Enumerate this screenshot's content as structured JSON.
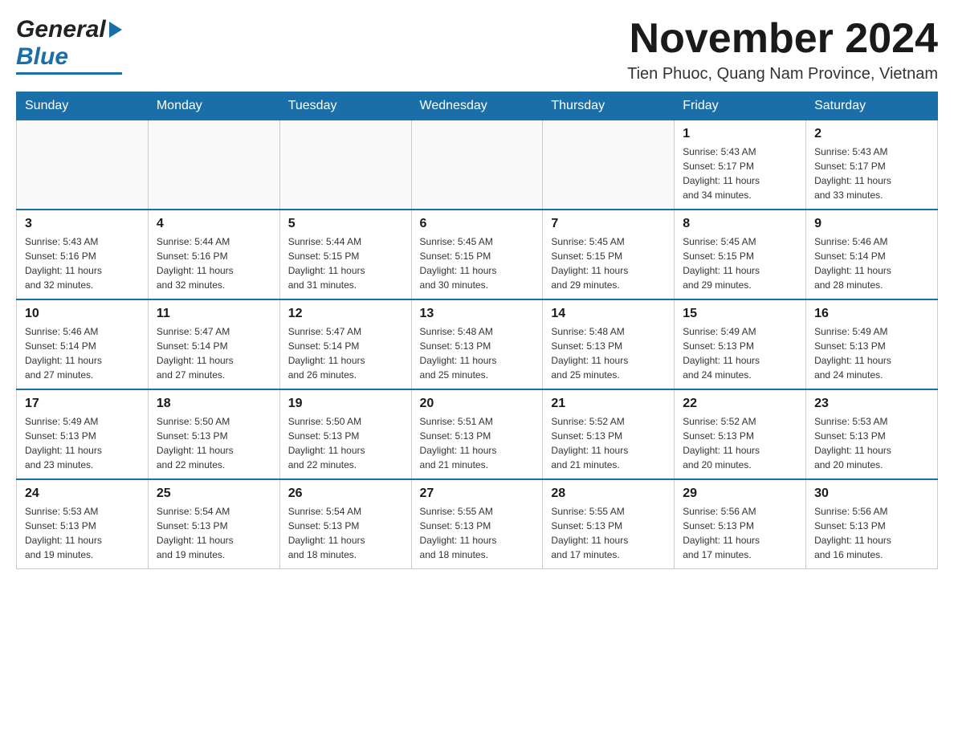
{
  "header": {
    "logo_general": "General",
    "logo_blue": "Blue",
    "month_title": "November 2024",
    "location": "Tien Phuoc, Quang Nam Province, Vietnam"
  },
  "calendar": {
    "days_of_week": [
      "Sunday",
      "Monday",
      "Tuesday",
      "Wednesday",
      "Thursday",
      "Friday",
      "Saturday"
    ],
    "weeks": [
      [
        {
          "day": "",
          "info": ""
        },
        {
          "day": "",
          "info": ""
        },
        {
          "day": "",
          "info": ""
        },
        {
          "day": "",
          "info": ""
        },
        {
          "day": "",
          "info": ""
        },
        {
          "day": "1",
          "info": "Sunrise: 5:43 AM\nSunset: 5:17 PM\nDaylight: 11 hours\nand 34 minutes."
        },
        {
          "day": "2",
          "info": "Sunrise: 5:43 AM\nSunset: 5:17 PM\nDaylight: 11 hours\nand 33 minutes."
        }
      ],
      [
        {
          "day": "3",
          "info": "Sunrise: 5:43 AM\nSunset: 5:16 PM\nDaylight: 11 hours\nand 32 minutes."
        },
        {
          "day": "4",
          "info": "Sunrise: 5:44 AM\nSunset: 5:16 PM\nDaylight: 11 hours\nand 32 minutes."
        },
        {
          "day": "5",
          "info": "Sunrise: 5:44 AM\nSunset: 5:15 PM\nDaylight: 11 hours\nand 31 minutes."
        },
        {
          "day": "6",
          "info": "Sunrise: 5:45 AM\nSunset: 5:15 PM\nDaylight: 11 hours\nand 30 minutes."
        },
        {
          "day": "7",
          "info": "Sunrise: 5:45 AM\nSunset: 5:15 PM\nDaylight: 11 hours\nand 29 minutes."
        },
        {
          "day": "8",
          "info": "Sunrise: 5:45 AM\nSunset: 5:15 PM\nDaylight: 11 hours\nand 29 minutes."
        },
        {
          "day": "9",
          "info": "Sunrise: 5:46 AM\nSunset: 5:14 PM\nDaylight: 11 hours\nand 28 minutes."
        }
      ],
      [
        {
          "day": "10",
          "info": "Sunrise: 5:46 AM\nSunset: 5:14 PM\nDaylight: 11 hours\nand 27 minutes."
        },
        {
          "day": "11",
          "info": "Sunrise: 5:47 AM\nSunset: 5:14 PM\nDaylight: 11 hours\nand 27 minutes."
        },
        {
          "day": "12",
          "info": "Sunrise: 5:47 AM\nSunset: 5:14 PM\nDaylight: 11 hours\nand 26 minutes."
        },
        {
          "day": "13",
          "info": "Sunrise: 5:48 AM\nSunset: 5:13 PM\nDaylight: 11 hours\nand 25 minutes."
        },
        {
          "day": "14",
          "info": "Sunrise: 5:48 AM\nSunset: 5:13 PM\nDaylight: 11 hours\nand 25 minutes."
        },
        {
          "day": "15",
          "info": "Sunrise: 5:49 AM\nSunset: 5:13 PM\nDaylight: 11 hours\nand 24 minutes."
        },
        {
          "day": "16",
          "info": "Sunrise: 5:49 AM\nSunset: 5:13 PM\nDaylight: 11 hours\nand 24 minutes."
        }
      ],
      [
        {
          "day": "17",
          "info": "Sunrise: 5:49 AM\nSunset: 5:13 PM\nDaylight: 11 hours\nand 23 minutes."
        },
        {
          "day": "18",
          "info": "Sunrise: 5:50 AM\nSunset: 5:13 PM\nDaylight: 11 hours\nand 22 minutes."
        },
        {
          "day": "19",
          "info": "Sunrise: 5:50 AM\nSunset: 5:13 PM\nDaylight: 11 hours\nand 22 minutes."
        },
        {
          "day": "20",
          "info": "Sunrise: 5:51 AM\nSunset: 5:13 PM\nDaylight: 11 hours\nand 21 minutes."
        },
        {
          "day": "21",
          "info": "Sunrise: 5:52 AM\nSunset: 5:13 PM\nDaylight: 11 hours\nand 21 minutes."
        },
        {
          "day": "22",
          "info": "Sunrise: 5:52 AM\nSunset: 5:13 PM\nDaylight: 11 hours\nand 20 minutes."
        },
        {
          "day": "23",
          "info": "Sunrise: 5:53 AM\nSunset: 5:13 PM\nDaylight: 11 hours\nand 20 minutes."
        }
      ],
      [
        {
          "day": "24",
          "info": "Sunrise: 5:53 AM\nSunset: 5:13 PM\nDaylight: 11 hours\nand 19 minutes."
        },
        {
          "day": "25",
          "info": "Sunrise: 5:54 AM\nSunset: 5:13 PM\nDaylight: 11 hours\nand 19 minutes."
        },
        {
          "day": "26",
          "info": "Sunrise: 5:54 AM\nSunset: 5:13 PM\nDaylight: 11 hours\nand 18 minutes."
        },
        {
          "day": "27",
          "info": "Sunrise: 5:55 AM\nSunset: 5:13 PM\nDaylight: 11 hours\nand 18 minutes."
        },
        {
          "day": "28",
          "info": "Sunrise: 5:55 AM\nSunset: 5:13 PM\nDaylight: 11 hours\nand 17 minutes."
        },
        {
          "day": "29",
          "info": "Sunrise: 5:56 AM\nSunset: 5:13 PM\nDaylight: 11 hours\nand 17 minutes."
        },
        {
          "day": "30",
          "info": "Sunrise: 5:56 AM\nSunset: 5:13 PM\nDaylight: 11 hours\nand 16 minutes."
        }
      ]
    ]
  }
}
